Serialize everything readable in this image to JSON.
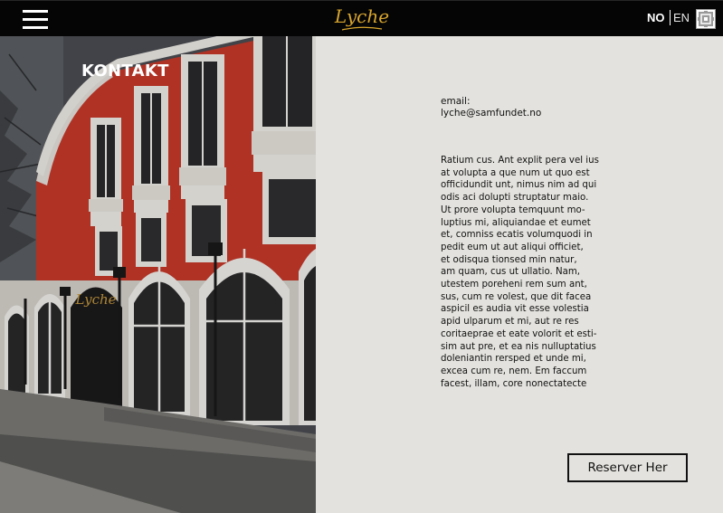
{
  "header": {
    "logo_text": "Lyche",
    "lang_no": "NO",
    "lang_en": "EN",
    "menu_icon": "hamburger-menu-icon",
    "external_icon": "qr-pattern-icon",
    "colors": {
      "bar": "#050505",
      "logo": "#d9a62e"
    }
  },
  "hero": {
    "heading": "KONTAKT",
    "sign_text": "Lyche"
  },
  "contact": {
    "email_label": "email:",
    "email_value": "lyche@samfundet.no"
  },
  "body_lines": [
    "Ratium cus. Ant explit pera vel ius",
    "at volupta a que num ut quo est",
    "officidundit unt, nimus nim ad qui",
    "odis aci dolupti struptatur maio.",
    "Ut prore volupta temquunt mo-",
    "luptius mi, aliquiandae et eumet",
    "et, comniss ecatis volumquodi in",
    "pedit eum ut aut aliqui officiet,",
    "et odisqua tionsed min natur,",
    "am quam, cus ut ullatio. Nam,",
    "utestem poreheni rem sum ant,",
    "sus, cum re volest, que dit facea",
    "aspicil es audia vit esse volestia",
    "apid ulparum et mi, aut re res",
    "coritaeprae et eate volorit et esti-",
    "sim aut pre, et ea nis nulluptatius",
    "doleniantin rersped et unde mi,",
    "excea cum re, nem. Em faccum",
    "facest, illam, core nonectatecte"
  ],
  "actions": {
    "reserve_label": "Reserver Her"
  },
  "theme": {
    "page_bg": "#e3e2de",
    "text": "#111111",
    "building_red": "#c8392b"
  }
}
